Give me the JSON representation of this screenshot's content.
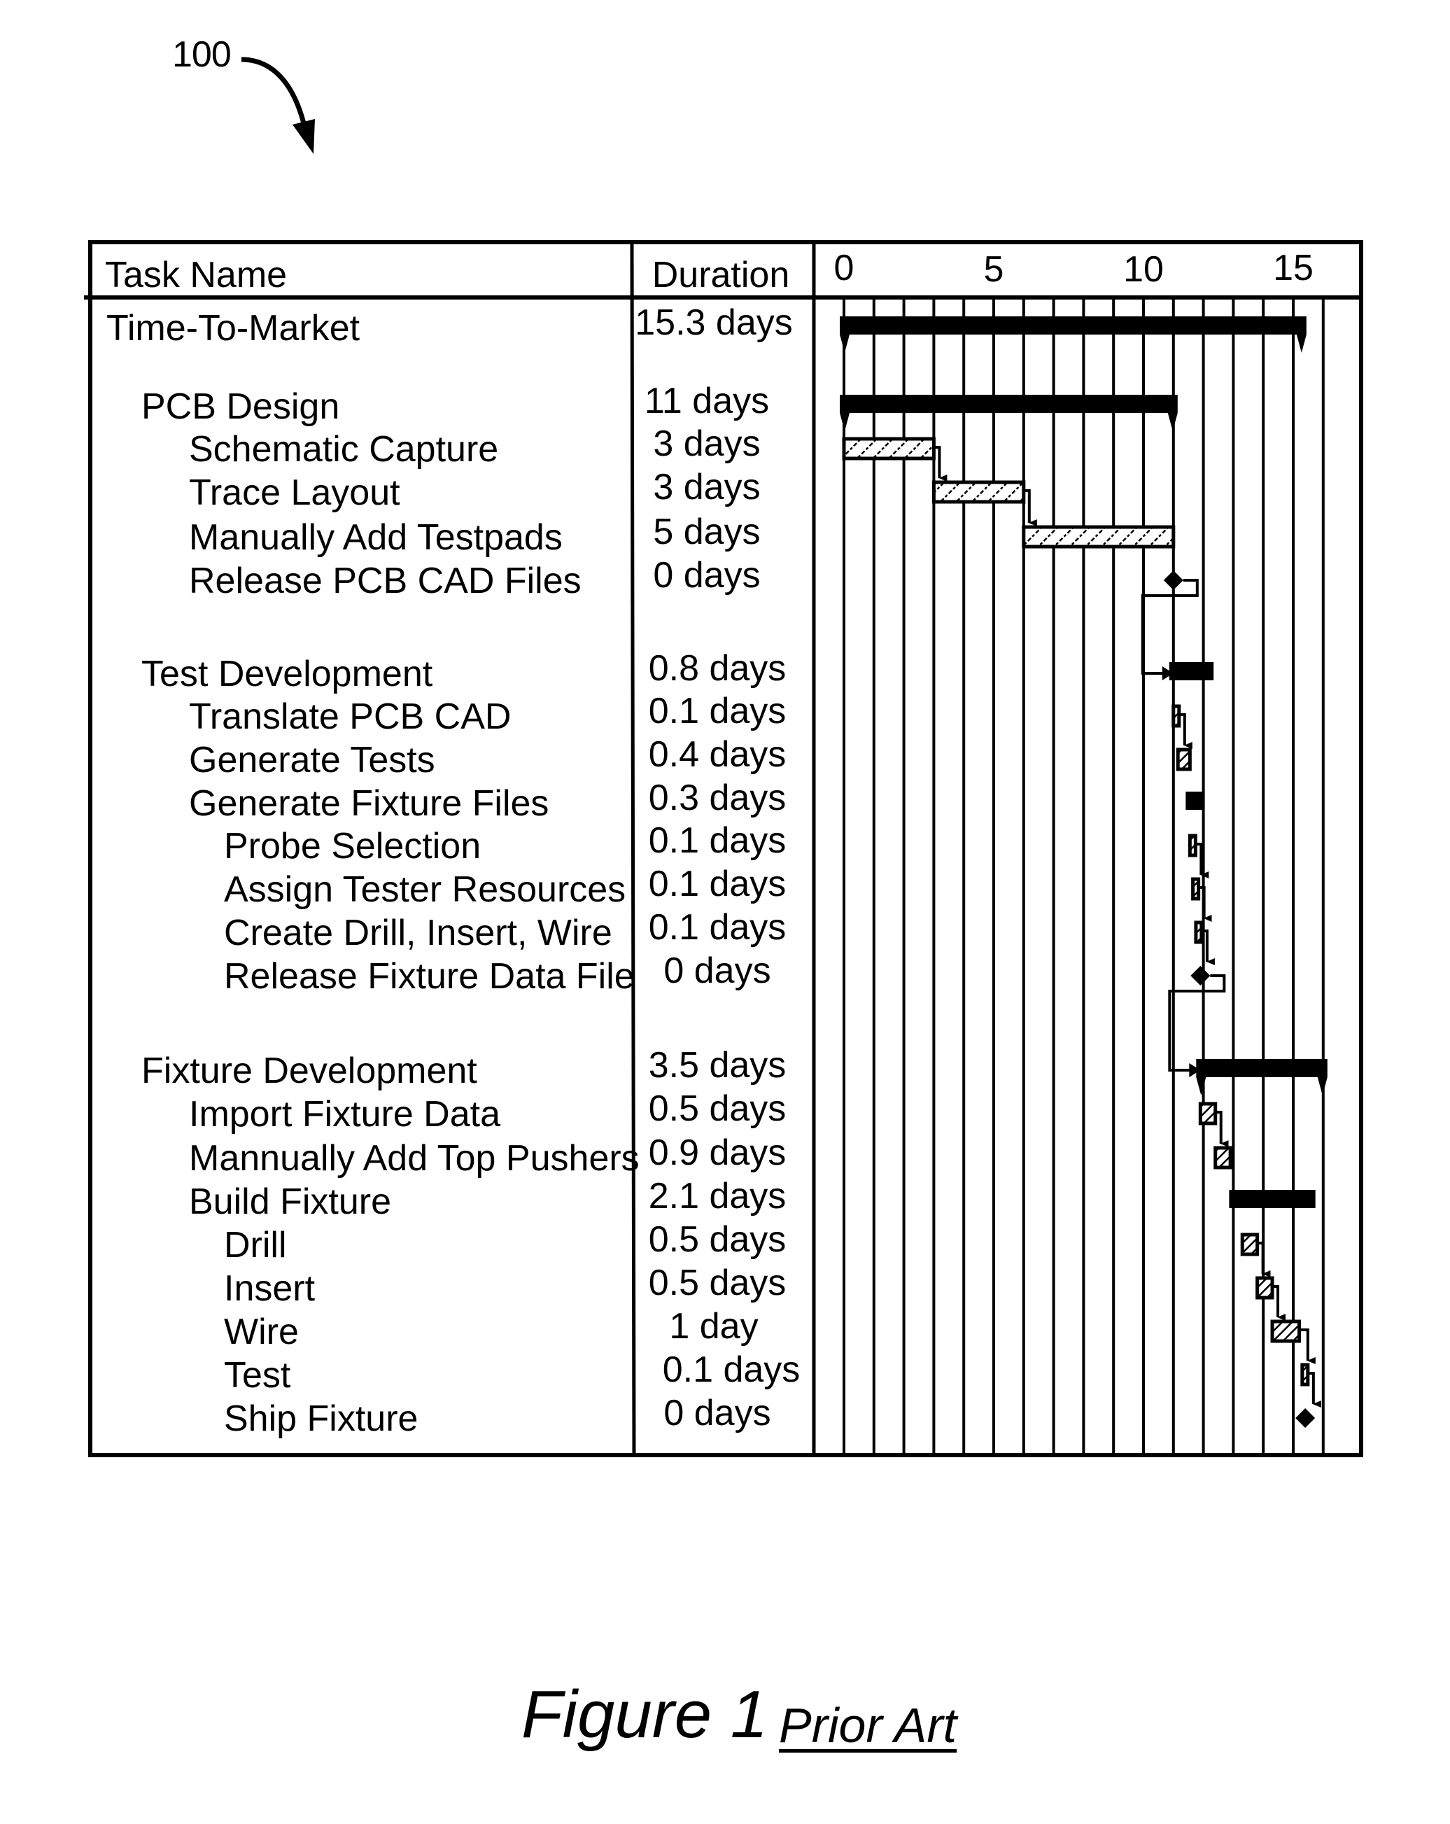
{
  "figure": {
    "reference_numeral": "100",
    "caption": "Figure 1",
    "caption_note": "Prior Art"
  },
  "table": {
    "headers": {
      "task_name": "Task Name",
      "duration": "Duration"
    },
    "timeline_ticks": [
      "0",
      "5",
      "10",
      "15"
    ]
  },
  "chart_data": {
    "type": "gantt",
    "title": "",
    "xlabel": "",
    "x_ticks": [
      0,
      5,
      10,
      15
    ],
    "x_range": [
      0,
      17
    ],
    "grid": true,
    "tasks": [
      {
        "name": "Time-To-Market",
        "duration": "15.3 days",
        "level": 0,
        "kind": "summary",
        "start": 0.0,
        "end": 15.3
      },
      {
        "name": "PCB Design",
        "duration": "11 days",
        "level": 1,
        "kind": "summary",
        "start": 0.0,
        "end": 11.0
      },
      {
        "name": "Schematic Capture",
        "duration": "3 days",
        "level": 2,
        "kind": "task",
        "start": 0.0,
        "end": 3.0
      },
      {
        "name": "Trace Layout",
        "duration": "3 days",
        "level": 2,
        "kind": "task",
        "start": 3.0,
        "end": 6.0
      },
      {
        "name": "Manually Add Testpads",
        "duration": "5 days",
        "level": 2,
        "kind": "task",
        "start": 6.0,
        "end": 11.0
      },
      {
        "name": "Release PCB CAD Files",
        "duration": "0 days",
        "level": 2,
        "kind": "milestone",
        "start": 11.0,
        "end": 11.0
      },
      {
        "name": "Test Development",
        "duration": "0.8 days",
        "level": 1,
        "kind": "summary",
        "start": 11.0,
        "end": 12.2
      },
      {
        "name": "Translate PCB CAD",
        "duration": "0.1 days",
        "level": 2,
        "kind": "task",
        "start": 11.0,
        "end": 11.15
      },
      {
        "name": "Generate Tests",
        "duration": "0.4 days",
        "level": 2,
        "kind": "task",
        "start": 11.15,
        "end": 11.55
      },
      {
        "name": "Generate Fixture Files",
        "duration": "0.3 days",
        "level": 2,
        "kind": "summary",
        "start": 11.55,
        "end": 11.9
      },
      {
        "name": "Probe Selection",
        "duration": "0.1 days",
        "level": 3,
        "kind": "task",
        "start": 11.55,
        "end": 11.65
      },
      {
        "name": "Assign Tester Resources",
        "duration": "0.1 days",
        "level": 3,
        "kind": "task",
        "start": 11.65,
        "end": 11.75
      },
      {
        "name": "Create Drill, Insert, Wire",
        "duration": "0.1 days",
        "level": 3,
        "kind": "task",
        "start": 11.75,
        "end": 11.9
      },
      {
        "name": "Release Fixture Data File",
        "duration": "0 days",
        "level": 3,
        "kind": "milestone",
        "start": 11.9,
        "end": 11.9
      },
      {
        "name": "Fixture Development",
        "duration": "3.5 days",
        "level": 1,
        "kind": "summary",
        "start": 11.9,
        "end": 16.0
      },
      {
        "name": "Import Fixture Data",
        "duration": "0.5 days",
        "level": 2,
        "kind": "task",
        "start": 11.9,
        "end": 12.4
      },
      {
        "name": "Mannually Add Top Pushers",
        "duration": "0.9 days",
        "level": 2,
        "kind": "task",
        "start": 12.4,
        "end": 12.9
      },
      {
        "name": "Build Fixture",
        "duration": "2.1 days",
        "level": 2,
        "kind": "summary",
        "start": 13.0,
        "end": 15.6
      },
      {
        "name": "Drill",
        "duration": "0.5 days",
        "level": 3,
        "kind": "task",
        "start": 13.3,
        "end": 13.8
      },
      {
        "name": "Insert",
        "duration": "0.5 days",
        "level": 3,
        "kind": "task",
        "start": 13.8,
        "end": 14.3
      },
      {
        "name": "Wire",
        "duration": "1 day",
        "level": 3,
        "kind": "task",
        "start": 14.3,
        "end": 15.2
      },
      {
        "name": "Test",
        "duration": "0.1 days",
        "level": 3,
        "kind": "task",
        "start": 15.3,
        "end": 15.4
      },
      {
        "name": "Ship Fixture",
        "duration": "0 days",
        "level": 3,
        "kind": "milestone",
        "start": 15.4,
        "end": 15.4
      }
    ]
  }
}
